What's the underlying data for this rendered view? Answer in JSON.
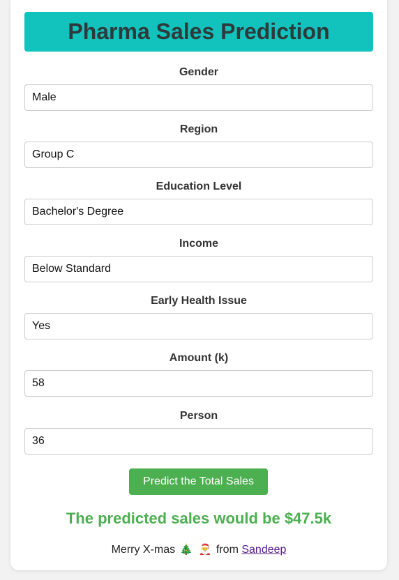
{
  "header": {
    "title": "Pharma Sales Prediction",
    "accent_color": "#12c2bd"
  },
  "form": {
    "fields": [
      {
        "label": "Gender",
        "value": "Male"
      },
      {
        "label": "Region",
        "value": "Group C"
      },
      {
        "label": "Education Level",
        "value": "Bachelor's Degree"
      },
      {
        "label": "Income",
        "value": "Below Standard"
      },
      {
        "label": "Early Health Issue",
        "value": "Yes"
      },
      {
        "label": "Amount (k)",
        "value": "58"
      },
      {
        "label": "Person",
        "value": "36"
      }
    ],
    "submit_label": "Predict the Total Sales",
    "submit_color": "#4caf50"
  },
  "result": {
    "text": "The predicted sales would be $47.5k"
  },
  "footer": {
    "prefix": "Merry X-mas",
    "emoji_tree": "🎄",
    "emoji_santa": "🎅",
    "from": "from",
    "author_link": "Sandeep"
  }
}
